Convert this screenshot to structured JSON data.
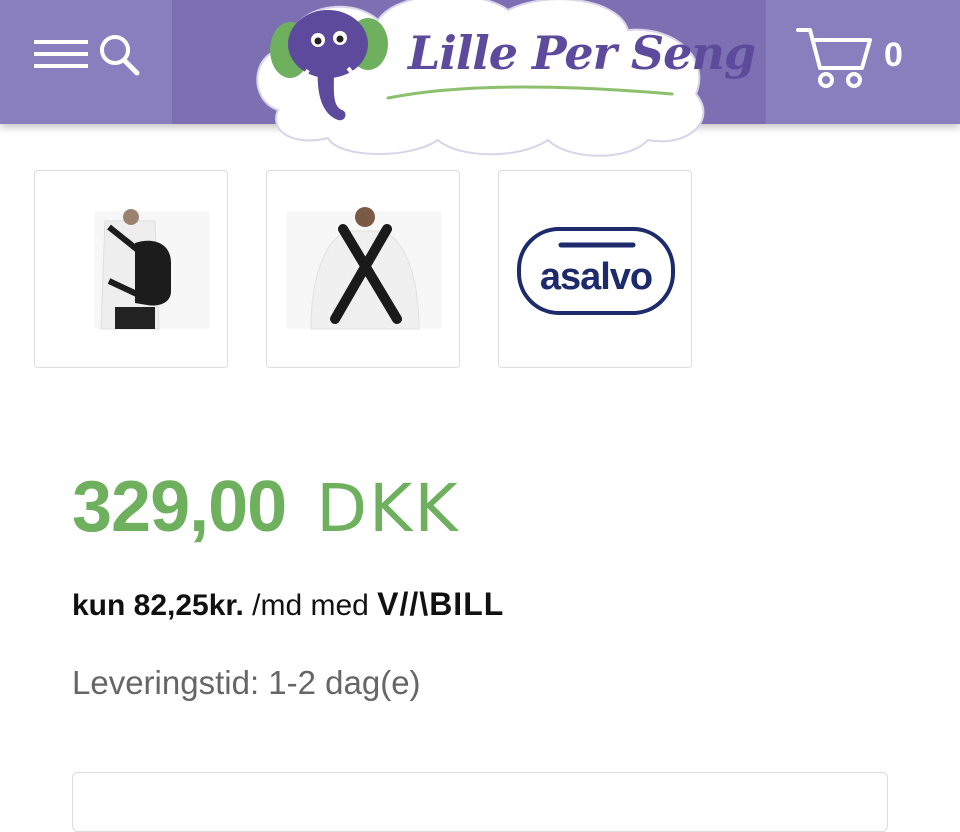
{
  "header": {
    "logo_text": "Lille Per Seng",
    "cart_count": "0",
    "colors": {
      "header_bg": "#7c70b3",
      "header_side_bg": "#8a7fbe"
    },
    "icons": {
      "menu": "hamburger-icon",
      "search": "search-icon",
      "cart": "cart-icon",
      "logo": "elephant-logo"
    }
  },
  "thumbnails": [
    {
      "name": "man-wearing-carrier-side",
      "kind": "photo"
    },
    {
      "name": "carrier-straps-back",
      "kind": "photo"
    },
    {
      "name": "asalvo-brand",
      "kind": "logo",
      "logo_text": "asalvo"
    }
  ],
  "product": {
    "price_amount": "329,00",
    "price_currency": "DKK",
    "price_color": "#6fb05f",
    "installment_prefix": "kun 82,25kr.",
    "installment_middle": " /md med ",
    "installment_provider": "V//\\BILL",
    "delivery": "Leveringstid: 1-2 dag(e)"
  }
}
